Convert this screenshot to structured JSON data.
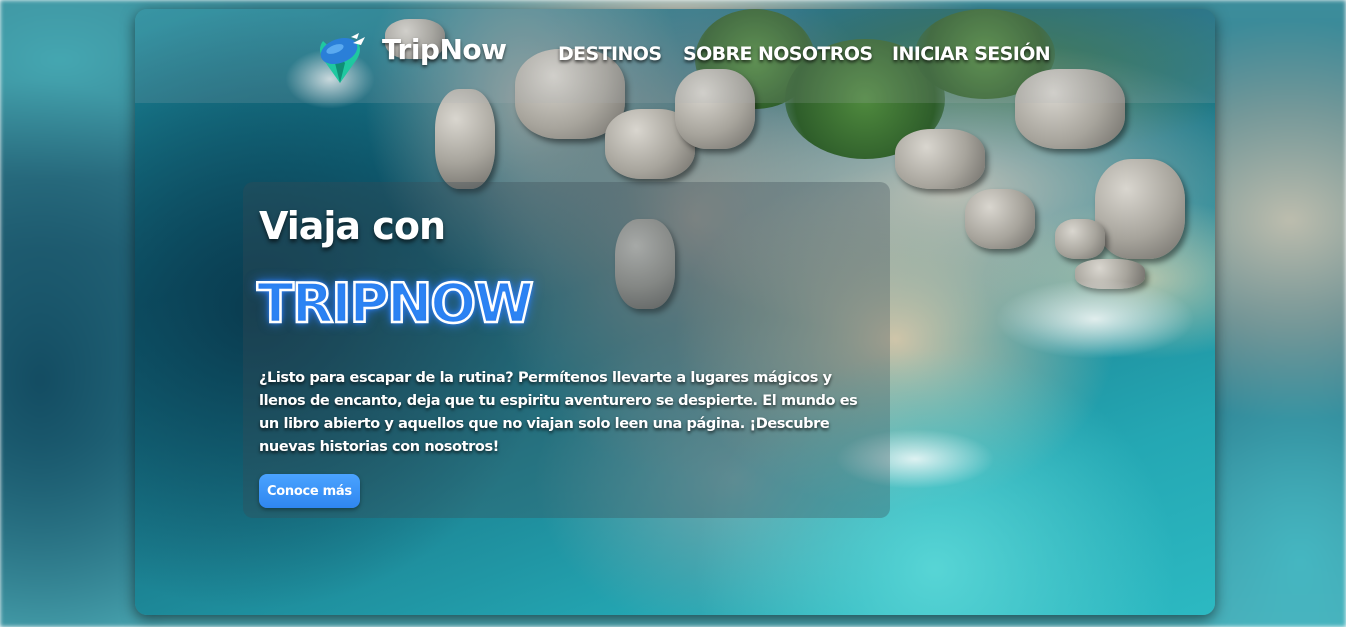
{
  "header": {
    "brand": "TripNow",
    "logo_icon": "plane-pin-icon",
    "nav": [
      {
        "label": "DESTINOS"
      },
      {
        "label": "SOBRE NOSOTROS"
      },
      {
        "label": "INICIAR SESIÓN"
      }
    ]
  },
  "hero": {
    "heading": "Viaja con",
    "brand_title": "TRIPNOW",
    "description": "¿Listo para escapar de la rutina? Permítenos llevarte a lugares mágicos y llenos de encanto, deja que tu espiritu aventurero se despierte. El mundo es un libro abierto y aquellos que no viajan solo leen una página. ¡Descubre nuevas historias con nosotros!",
    "cta_label": "Conoce más"
  },
  "colors": {
    "accent": "#2f86f0",
    "glow": "#2f8bff",
    "logo_teal": "#1fc8a0",
    "logo_blue": "#2a7fd8"
  }
}
